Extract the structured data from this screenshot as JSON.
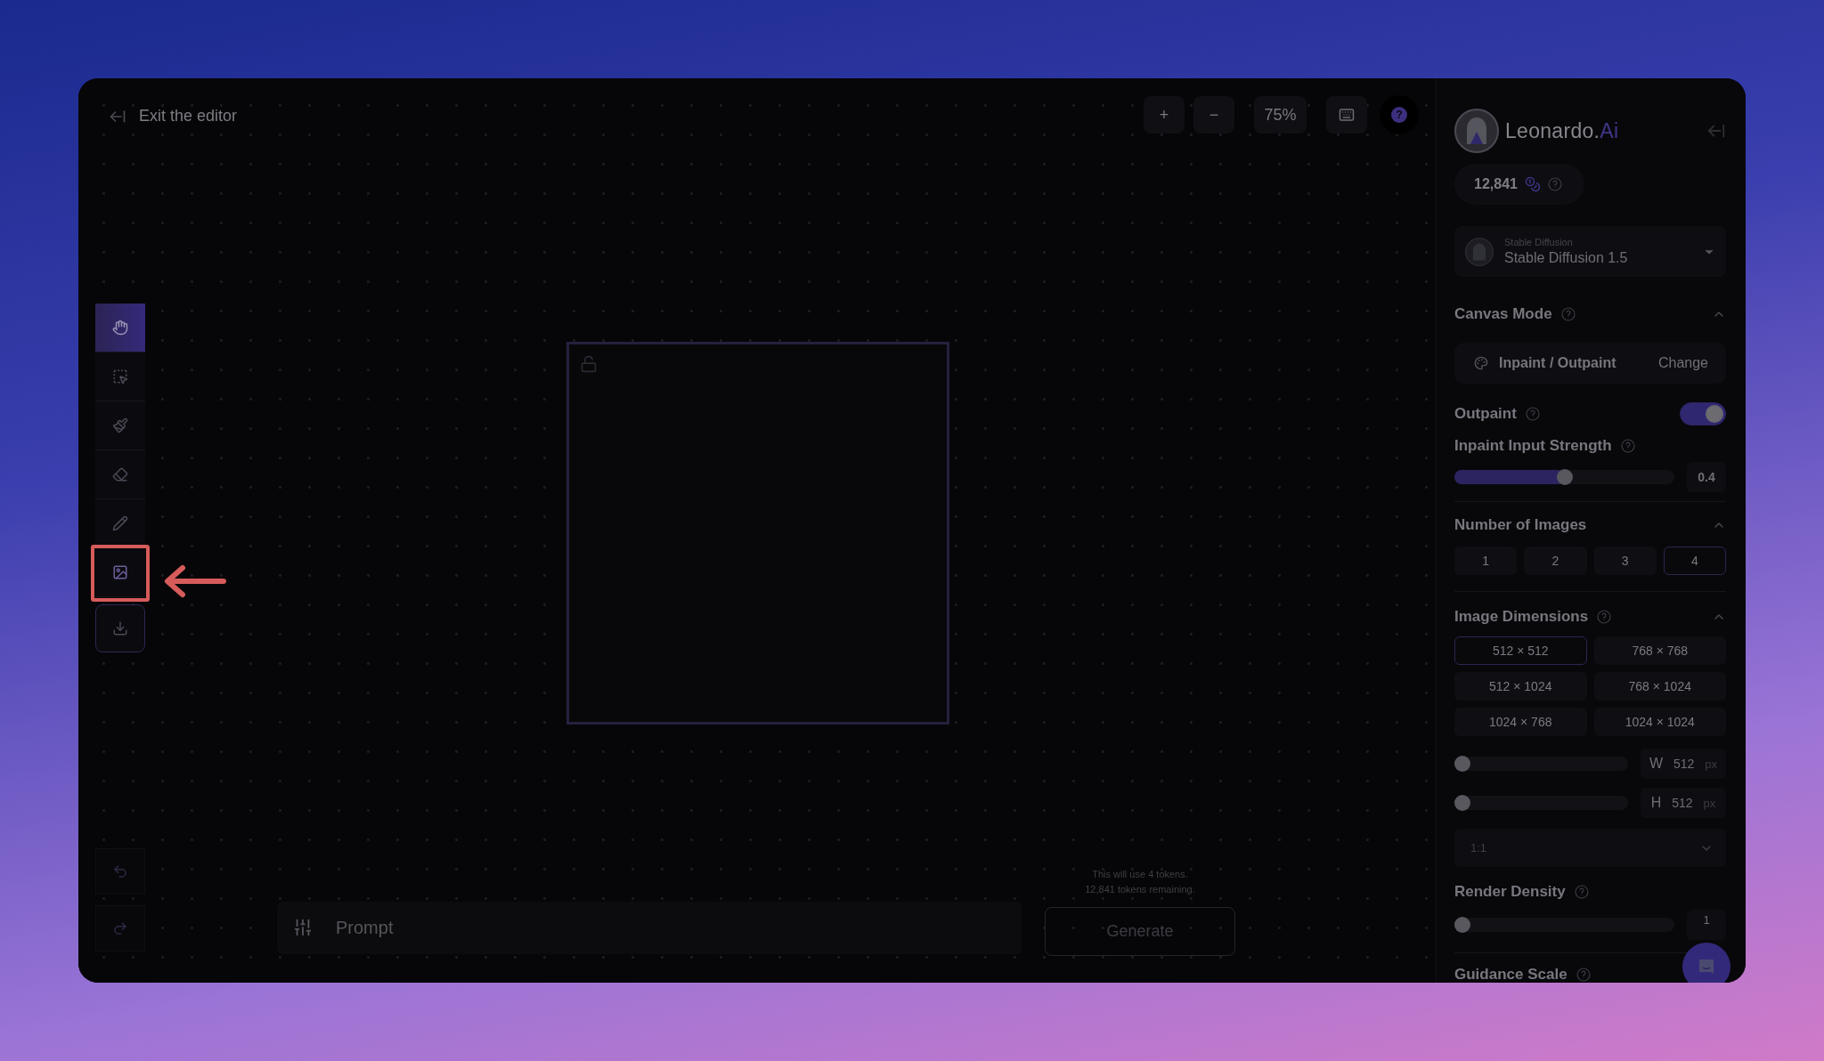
{
  "exit_link": "Exit the editor",
  "zoom_controls": {
    "zoom_in": "+",
    "zoom_out": "−",
    "zoom_level": "75%",
    "help": "?"
  },
  "tools": [
    {
      "kind": "hand",
      "selected": true,
      "annotated": false
    },
    {
      "kind": "select",
      "selected": false,
      "annotated": false
    },
    {
      "kind": "brush",
      "selected": false,
      "annotated": false
    },
    {
      "kind": "eraser",
      "selected": false,
      "annotated": false
    },
    {
      "kind": "pencil",
      "selected": false,
      "annotated": false
    },
    {
      "kind": "image",
      "selected": false,
      "annotated": true
    },
    {
      "kind": "download",
      "selected": false,
      "annotated": false
    }
  ],
  "history": [
    {
      "kind": "undo"
    },
    {
      "kind": "redo"
    }
  ],
  "prompt": {
    "placeholder": "Prompt"
  },
  "token_note": [
    "This will use 4 tokens.",
    "12,841 tokens remaining."
  ],
  "generate": {
    "label": "Generate",
    "disabled": true
  },
  "sidebar": {
    "brand": {
      "name": "Leonardo.",
      "accent": "Ai"
    },
    "credits": "12,841",
    "model": {
      "category": "Stable Diffusion",
      "name": "Stable Diffusion 1.5"
    },
    "canvas_mode": {
      "title": "Canvas Mode",
      "expanded": true,
      "mode": "Inpaint / Outpaint",
      "change": "Change"
    },
    "outpaint": {
      "label": "Outpaint",
      "on": true
    },
    "inpaint_strength": {
      "label": "Inpaint Input Strength",
      "level": 0.5,
      "reading": "0.4"
    },
    "number_of_images": {
      "title": "Number of Images",
      "expanded": true,
      "options": [
        {
          "label": "1",
          "selected": false
        },
        {
          "label": "2",
          "selected": false
        },
        {
          "label": "3",
          "selected": false
        },
        {
          "label": "4",
          "selected": true
        }
      ]
    },
    "image_dimensions": {
      "title": "Image Dimensions",
      "expanded": true,
      "presets": [
        {
          "label": "512 × 512",
          "selected": true
        },
        {
          "label": "768 × 768",
          "selected": false
        },
        {
          "label": "512 × 1024",
          "selected": false
        },
        {
          "label": "768 × 1024",
          "selected": false
        },
        {
          "label": "1024 × 768",
          "selected": false
        },
        {
          "label": "1024 × 1024",
          "selected": false
        }
      ],
      "sizes": [
        {
          "axis": "W",
          "value": "512",
          "unit": "px",
          "level": 0
        },
        {
          "axis": "H",
          "value": "512",
          "unit": "px",
          "level": 0
        }
      ],
      "aspect": "1:1"
    },
    "render_density": {
      "title": "Render Density",
      "level": 0,
      "reading": "1"
    },
    "guidance_scale": {
      "title": "Guidance Scale"
    }
  }
}
